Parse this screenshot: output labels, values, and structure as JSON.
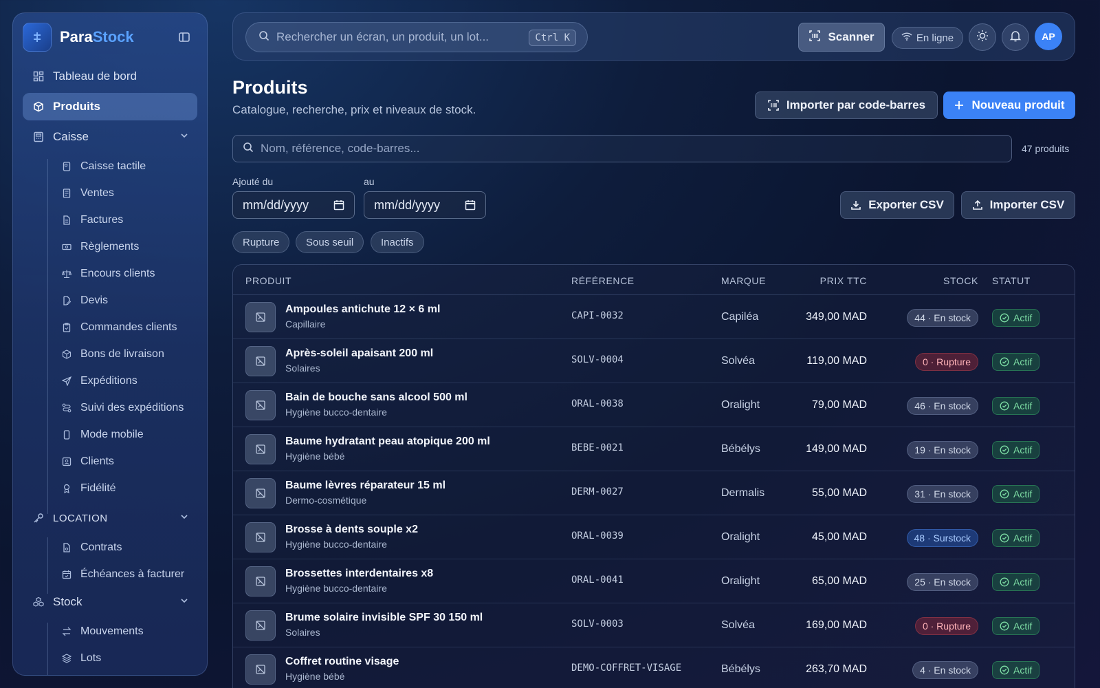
{
  "sidebar": {
    "brand_a": "Para",
    "brand_b": "Stock",
    "items": [
      {
        "label": "Tableau de bord",
        "icon": "dashboard-icon"
      },
      {
        "label": "Produits",
        "icon": "box-icon"
      },
      {
        "label": "Caisse",
        "icon": "register-icon"
      }
    ],
    "caisse_sub": [
      {
        "label": "Caisse tactile",
        "icon": "tablet-icon"
      },
      {
        "label": "Ventes",
        "icon": "receipt-icon"
      },
      {
        "label": "Factures",
        "icon": "file-icon"
      },
      {
        "label": "Règlements",
        "icon": "banknote-icon"
      },
      {
        "label": "Encours clients",
        "icon": "scale-icon"
      },
      {
        "label": "Devis",
        "icon": "file-edit-icon"
      },
      {
        "label": "Commandes clients",
        "icon": "clipboard-icon"
      },
      {
        "label": "Bons de livraison",
        "icon": "package-icon"
      },
      {
        "label": "Expéditions",
        "icon": "send-icon"
      },
      {
        "label": "Suivi des expéditions",
        "icon": "route-icon"
      },
      {
        "label": "Mode mobile",
        "icon": "smartphone-icon"
      },
      {
        "label": "Clients",
        "icon": "contact-icon"
      },
      {
        "label": "Fidélité",
        "icon": "award-icon"
      }
    ],
    "location": "LOCATION",
    "location_sub": [
      {
        "label": "Contrats",
        "icon": "contract-icon"
      },
      {
        "label": "Échéances à facturer",
        "icon": "calendar-icon"
      }
    ],
    "stock": "Stock",
    "stock_sub": [
      {
        "label": "Mouvements",
        "icon": "arrows-icon"
      },
      {
        "label": "Lots",
        "icon": "layers-icon"
      }
    ]
  },
  "topbar": {
    "search_placeholder": "Rechercher un écran, un produit, un lot...",
    "shortcut": "Ctrl K",
    "scan_label": "Scanner",
    "online_label": "En ligne",
    "avatar": "AP"
  },
  "header": {
    "title": "Produits",
    "subtitle": "Catalogue, recherche, prix et niveaux de stock.",
    "import_barcode": "Importer par code-barres",
    "new_product": "Nouveau produit"
  },
  "filters": {
    "search_placeholder": "Nom, référence, code-barres...",
    "count": "47 produits",
    "added_from": "Ajouté du",
    "added_to": "au",
    "date_placeholder": "mm/dd/yyyy",
    "export_csv": "Exporter CSV",
    "import_csv": "Importer CSV",
    "chips": [
      "Rupture",
      "Sous seuil",
      "Inactifs"
    ]
  },
  "table": {
    "headers": {
      "product": "PRODUIT",
      "reference": "RÉFÉRENCE",
      "brand": "MARQUE",
      "price": "PRIX TTC",
      "stock": "STOCK",
      "status": "STATUT"
    },
    "rows": [
      {
        "name": "Ampoules antichute 12 × 6 ml",
        "category": "Capillaire",
        "ref": "CAPI-0032",
        "brand": "Capiléa",
        "price": "349,00 MAD",
        "stock": "44 · En stock",
        "stock_kind": "ok",
        "status": "Actif"
      },
      {
        "name": "Après-soleil apaisant 200 ml",
        "category": "Solaires",
        "ref": "SOLV-0004",
        "brand": "Solvéa",
        "price": "119,00 MAD",
        "stock": "0 · Rupture",
        "stock_kind": "out",
        "status": "Actif"
      },
      {
        "name": "Bain de bouche sans alcool 500 ml",
        "category": "Hygiène bucco-dentaire",
        "ref": "ORAL-0038",
        "brand": "Oralight",
        "price": "79,00 MAD",
        "stock": "46 · En stock",
        "stock_kind": "ok",
        "status": "Actif"
      },
      {
        "name": "Baume hydratant peau atopique 200 ml",
        "category": "Hygiène bébé",
        "ref": "BEBE-0021",
        "brand": "Bébélys",
        "price": "149,00 MAD",
        "stock": "19 · En stock",
        "stock_kind": "ok",
        "status": "Actif"
      },
      {
        "name": "Baume lèvres réparateur 15 ml",
        "category": "Dermo-cosmétique",
        "ref": "DERM-0027",
        "brand": "Dermalis",
        "price": "55,00 MAD",
        "stock": "31 · En stock",
        "stock_kind": "ok",
        "status": "Actif"
      },
      {
        "name": "Brosse à dents souple x2",
        "category": "Hygiène bucco-dentaire",
        "ref": "ORAL-0039",
        "brand": "Oralight",
        "price": "45,00 MAD",
        "stock": "48 · Surstock",
        "stock_kind": "over",
        "status": "Actif"
      },
      {
        "name": "Brossettes interdentaires x8",
        "category": "Hygiène bucco-dentaire",
        "ref": "ORAL-0041",
        "brand": "Oralight",
        "price": "65,00 MAD",
        "stock": "25 · En stock",
        "stock_kind": "ok",
        "status": "Actif"
      },
      {
        "name": "Brume solaire invisible SPF 30 150 ml",
        "category": "Solaires",
        "ref": "SOLV-0003",
        "brand": "Solvéa",
        "price": "169,00 MAD",
        "stock": "0 · Rupture",
        "stock_kind": "out",
        "status": "Actif"
      },
      {
        "name": "Coffret routine visage",
        "category": "Hygiène bébé",
        "ref": "DEMO-COFFRET-VISAGE",
        "brand": "Bébélys",
        "price": "263,70 MAD",
        "stock": "4 · En stock",
        "stock_kind": "ok",
        "status": "Actif"
      }
    ]
  },
  "colors": {
    "accent": "#3b82f6",
    "status_active": "#7fe0a6",
    "stock_out": "#ffb3b8",
    "stock_over": "#a9cbff"
  }
}
